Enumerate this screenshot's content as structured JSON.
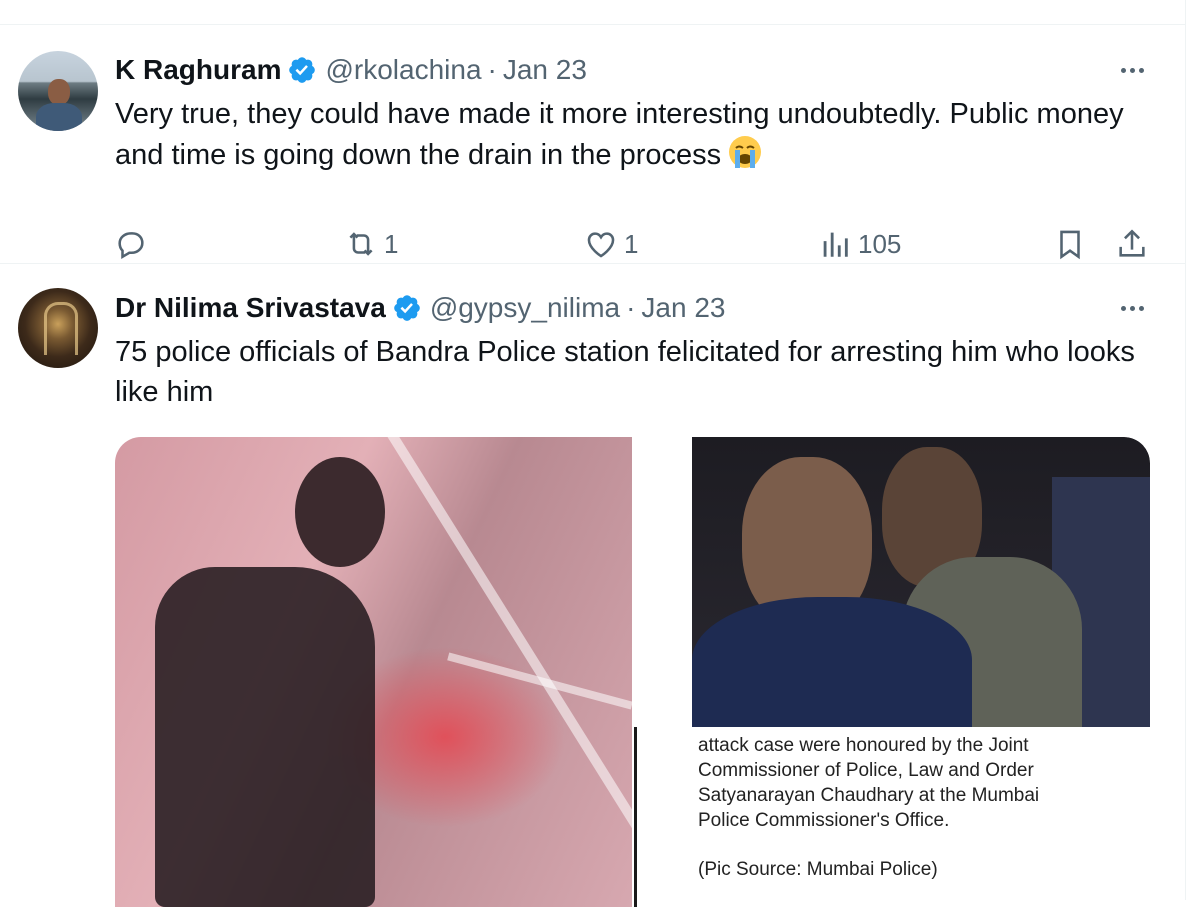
{
  "tweets": [
    {
      "name": "K Raghuram",
      "handle": "@rkolachina",
      "separator": "·",
      "date": "Jan 23",
      "text": "Very true, they could have made it more interesting undoubtedly. Public money and time is going down the drain in the process",
      "emoji": "loudly-crying-face",
      "actions": {
        "reply_icon": "reply-icon",
        "retweets": "1",
        "likes": "1",
        "views": "105",
        "bookmark_icon": "bookmark-icon",
        "share_icon": "share-icon"
      }
    },
    {
      "name": "Dr Nilima Srivastava",
      "handle": "@gypsy_nilima",
      "separator": "·",
      "date": "Jan 23",
      "text": "75 police officials of Bandra Police station felicitated for arresting him who looks like him",
      "media": {
        "caption_lines": [
          "attack case were honoured by the Joint",
          "Commissioner of Police, Law and Order",
          "Satyanarayan Chaudhary at the Mumbai",
          "Police Commissioner's Office."
        ],
        "caption_source": "(Pic Source: Mumbai Police)"
      }
    }
  ],
  "colors": {
    "text": "#0f1419",
    "secondary": "#536471",
    "verified": "#1d9bf0",
    "border": "#eff3f4"
  }
}
